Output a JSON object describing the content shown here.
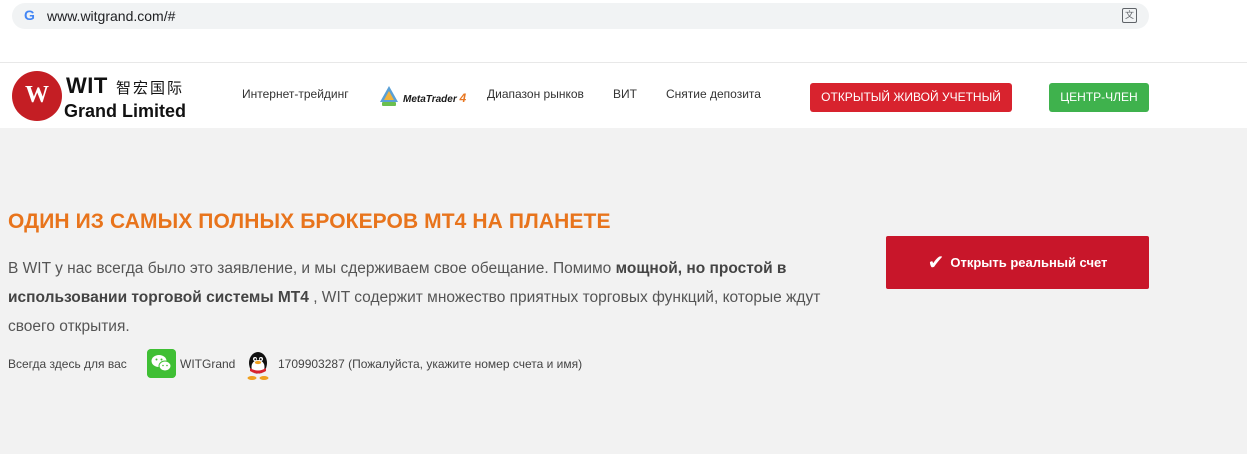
{
  "browser": {
    "url": "www.witgrand.com/#",
    "google_icon": "G",
    "translate_icon": "文"
  },
  "logo": {
    "name": "WIT",
    "chinese": "智宏国际",
    "subtitle": "Grand Limited",
    "mark": "W"
  },
  "nav": {
    "items": [
      {
        "label": "Интернет-трейдинг"
      },
      {
        "label": "MetaTrader",
        "suffix": "4"
      },
      {
        "label": "Диапазон рынков"
      },
      {
        "label": "ВИТ"
      },
      {
        "label": "Снятие депозита"
      }
    ],
    "open_live_label": "ОТКРЫТЫЙ ЖИВОЙ УЧЕТНЫЙ",
    "member_label": "ЦЕНТР-ЧЛЕН"
  },
  "hero": {
    "title": "ОДИН ИЗ САМЫХ ПОЛНЫХ БРОКЕРОВ МТ4 НА ПЛАНЕТЕ",
    "desc_part1": "В WIT у нас всегда было это заявление, и мы сдерживаем свое обещание. Помимо ",
    "desc_bold": "мощной, но простой в использовании торговой системы МТ4",
    "desc_part2": " , WIT содержит множество приятных торговых функций, которые ждут своего открытия.",
    "contact_label": "Всегда здесь для вас",
    "wechat_id": "WITGrand",
    "qq_text": "1709903287 (Пожалуйста, укажите номер счета и имя)",
    "open_real_label": "Открыть реальный счет",
    "check_icon": "✔"
  },
  "colors": {
    "brand_red": "#c8162a",
    "title_orange": "#e8741c",
    "member_green": "#3fb24d",
    "hero_bg": "#f2f2f2"
  }
}
